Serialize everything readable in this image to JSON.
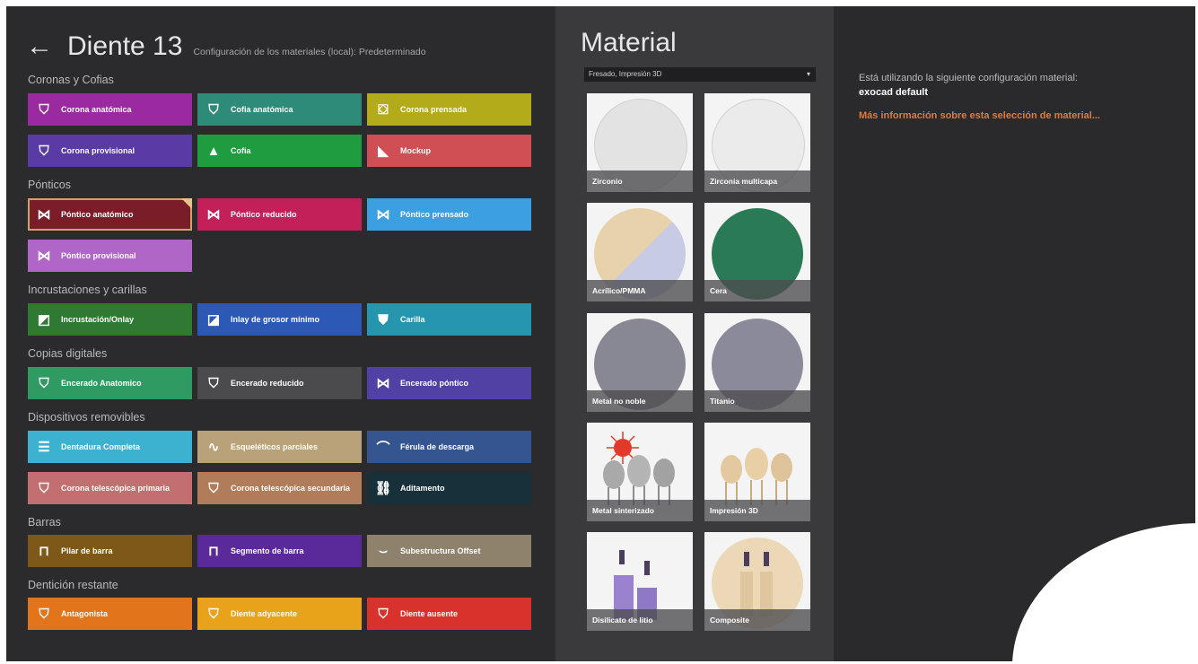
{
  "header": {
    "back_icon": "back-arrow-icon",
    "title": "Diente 13",
    "subtitle": "Configuración de los materiales (local): Predeterminado"
  },
  "sections": {
    "coronas": "Coronas y Cofias",
    "ponticos": "Pónticos",
    "incrustaciones": "Incrustaciones y carillas",
    "copias": "Copias digitales",
    "dispositivos": "Dispositivos removibles",
    "barras": "Barras",
    "denticion": "Dentición restante"
  },
  "tiles": {
    "corona_anatomica": {
      "label": "Corona anatómica",
      "color": "#9b2aa0"
    },
    "cofia_anatomica": {
      "label": "Cofia anatómica",
      "color": "#2f8b79"
    },
    "corona_prensada": {
      "label": "Corona prensada",
      "color": "#b4ab1b"
    },
    "corona_provisional": {
      "label": "Corona provisional",
      "color": "#5a3aa5"
    },
    "cofia": {
      "label": "Cofia",
      "color": "#1f9c3f"
    },
    "mockup": {
      "label": "Mockup",
      "color": "#d04f55"
    },
    "pontico_anatomico": {
      "label": "Póntico anatómico",
      "color": "#7a1d28"
    },
    "pontico_reducido": {
      "label": "Póntico reducido",
      "color": "#c3205a"
    },
    "pontico_prensado": {
      "label": "Póntico prensado",
      "color": "#3c9fe0"
    },
    "pontico_provisional": {
      "label": "Póntico provisional",
      "color": "#b066c6"
    },
    "incrustacion": {
      "label": "Incrustación/Onlay",
      "color": "#2e7a32"
    },
    "inlay_grosor": {
      "label": "Inlay de grosor mínimo",
      "color": "#2c59b6"
    },
    "carilla": {
      "label": "Carilla",
      "color": "#2596ad"
    },
    "encerado_anatomico": {
      "label": "Encerado Anatomico",
      "color": "#2f9b63"
    },
    "encerado_reducido": {
      "label": "Encerado reducido",
      "color": "#4b4b4d"
    },
    "encerado_pontico": {
      "label": "Encerado póntico",
      "color": "#5141a4"
    },
    "dentadura_completa": {
      "label": "Dentadura Completa",
      "color": "#3cb2d0"
    },
    "esqueleticos": {
      "label": "Esqueléticos parciales",
      "color": "#b9a27a"
    },
    "ferula": {
      "label": "Férula de descarga",
      "color": "#34558f"
    },
    "corona_telescopica_primaria": {
      "label": "Corona telescópica primaria",
      "color": "#c46f6f"
    },
    "corona_telescopica_secundaria": {
      "label": "Corona telescópica secundaria",
      "color": "#b07c5a"
    },
    "aditamento": {
      "label": "Aditamento",
      "color": "#17303a"
    },
    "pilar_barra": {
      "label": "Pilar de barra",
      "color": "#7d5818"
    },
    "segmento_barra": {
      "label": "Segmento de barra",
      "color": "#5a2a9a"
    },
    "subestructura": {
      "label": "Subestructura Offset",
      "color": "#8e826c"
    },
    "antagonista": {
      "label": "Antagonista",
      "color": "#e2741b"
    },
    "diente_adyacente": {
      "label": "Diente adyacente",
      "color": "#e9a31a"
    },
    "diente_ausente": {
      "label": "Diente ausente",
      "color": "#d9312c"
    }
  },
  "material": {
    "title": "Material",
    "dropdown_value": "Fresado, Impresión 3D",
    "cards": {
      "zirconio": {
        "label": "Zirconio",
        "color": "#e3e3e3"
      },
      "zirconia_multicapa": {
        "label": "Zirconia multicapa",
        "color": "#ebebeb"
      },
      "acrilico": {
        "label": "Acrílico/PMMA",
        "color": "#e8d2ac"
      },
      "cera": {
        "label": "Cera",
        "color": "#2a7a55"
      },
      "metal_no_noble": {
        "label": "Metal no noble",
        "color": "#878893"
      },
      "titanio": {
        "label": "Titanio",
        "color": "#8a8a9a"
      },
      "metal_sinterizado": {
        "label": "Metal sinterizado",
        "color": "#f4f4f4"
      },
      "impresion_3d": {
        "label": "Impresión 3D",
        "color": "#f4f4f4"
      },
      "disilicato": {
        "label": "Disilicato de litio",
        "color": "#f4f4f4"
      },
      "composite": {
        "label": "Composite",
        "color": "#ecd7b7"
      }
    }
  },
  "info": {
    "line1": "Está utilizando la siguiente configuración material:",
    "config": "exocad default",
    "link": "Más información sobre esta selección de material..."
  }
}
